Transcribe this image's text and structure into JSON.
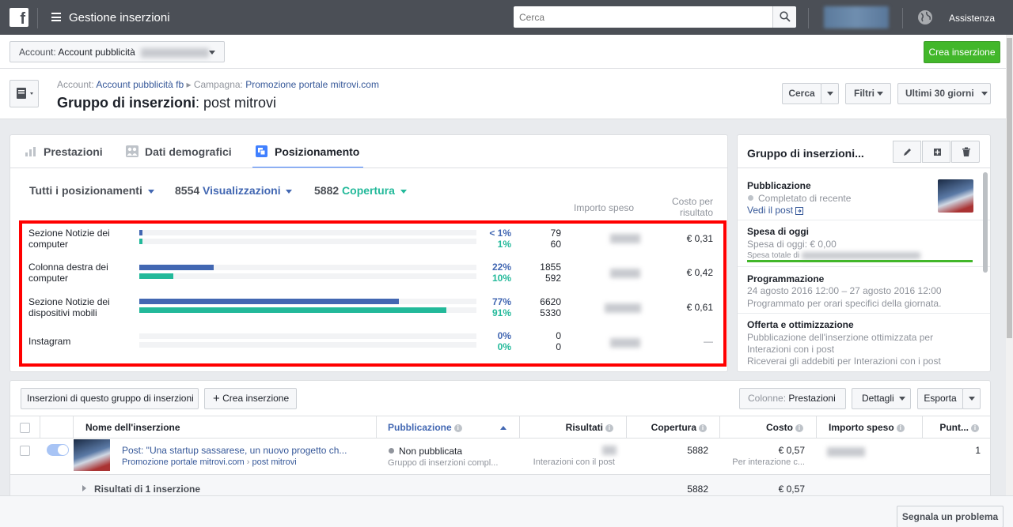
{
  "topbar": {
    "app_title": "Gestione inserzioni",
    "search_placeholder": "Cerca",
    "help": "Assistenza"
  },
  "account": {
    "label": "Account:",
    "value": "Account pubblicità",
    "create_button": "Crea inserzione"
  },
  "header": {
    "breadcrumb_account_label": "Account:",
    "breadcrumb_account": "Account pubblicità fb",
    "breadcrumb_campaign_label": "Campagna:",
    "breadcrumb_campaign": "Promozione portale mitrovi.com",
    "title_prefix": "Gruppo di inserzioni",
    "title_name": ": post mitrovi",
    "search_button": "Cerca",
    "filters_button": "Filtri",
    "date_range": "Ultimi 30 giorni"
  },
  "tabs": {
    "performance": "Prestazioni",
    "demographics": "Dati demografici",
    "placement": "Posizionamento"
  },
  "summary": {
    "all_placements": "Tutti i posizionamenti",
    "views_count": "8554",
    "views_label": "Visualizzazioni",
    "reach_count": "5882",
    "reach_label": "Copertura",
    "col_amount_spent": "Importo speso",
    "col_cost_per_result_1": "Costo per",
    "col_cost_per_result_2": "risultato"
  },
  "placements": [
    {
      "label": "Sezione Notizie dei computer",
      "views_pct": "< 1%",
      "reach_pct": "1%",
      "views_fraction": 0.01,
      "reach_fraction": 0.01,
      "views": "79",
      "reach": "60",
      "cost": "€ 0,31"
    },
    {
      "label": "Colonna destra dei computer",
      "views_pct": "22%",
      "reach_pct": "10%",
      "views_fraction": 0.22,
      "reach_fraction": 0.1,
      "views": "1855",
      "reach": "592",
      "cost": "€ 0,42"
    },
    {
      "label": "Sezione Notizie dei dispositivi mobili",
      "views_pct": "77%",
      "reach_pct": "91%",
      "views_fraction": 0.77,
      "reach_fraction": 0.91,
      "views": "6620",
      "reach": "5330",
      "cost": "€ 0,61"
    },
    {
      "label": "Instagram",
      "views_pct": "0%",
      "reach_pct": "0%",
      "views_fraction": 0,
      "reach_fraction": 0,
      "views": "0",
      "reach": "0",
      "cost": "—"
    }
  ],
  "right_panel": {
    "title": "Gruppo di inserzioni...",
    "publication_title": "Pubblicazione",
    "publication_status": "Completato di recente",
    "view_post": "Vedi il post",
    "spend_title": "Spesa di oggi",
    "spend_today": "Spesa di oggi: € 0,00",
    "spend_total": "Spesa totale di",
    "schedule_title": "Programmazione",
    "schedule_dates": "24 agosto 2016 12:00 – 27 agosto 2016 12:00",
    "schedule_note": "Programmato per orari specifici della giornata.",
    "offer_title": "Offerta e ottimizzazione",
    "offer_line1": "Pubblicazione dell'inserzione ottimizzata per",
    "offer_line2": "Interazioni con i post",
    "offer_line3": "Riceverai gli addebiti per Interazioni con i post"
  },
  "table_toolbar": {
    "ads_filter": "Inserzioni di questo gruppo di inserzioni",
    "create_ad": "Crea inserzione",
    "columns_label": "Colonne:",
    "columns_value": "Prestazioni",
    "details": "Dettagli",
    "export": "Esporta"
  },
  "table": {
    "headers": {
      "name": "Nome dell'inserzione",
      "delivery": "Pubblicazione",
      "results": "Risultati",
      "reach": "Copertura",
      "cost": "Costo",
      "amount_spent": "Importo speso",
      "score": "Punt..."
    },
    "row": {
      "name": "Post: \"Una startup sassarese, un nuovo progetto ch...",
      "campaign": "Promozione portale mitrovi.com",
      "adset": "post mitrovi",
      "delivery": "Non pubblicata",
      "delivery_sub": "Gruppo di inserzioni compl...",
      "results_sub": "Interazioni con il post",
      "reach": "5882",
      "cost": "€ 0,57",
      "cost_sub": "Per interazione c...",
      "score": "1"
    },
    "total": {
      "label": "Risultati di 1 inserzione",
      "reach": "5882",
      "cost": "€ 0,57"
    }
  },
  "footer": {
    "report_problem": "Segnala un problema"
  },
  "colors": {
    "views": "#4267b2",
    "reach": "#23b99a",
    "highlight": "#ff0000",
    "green_button": "#42b72a"
  }
}
